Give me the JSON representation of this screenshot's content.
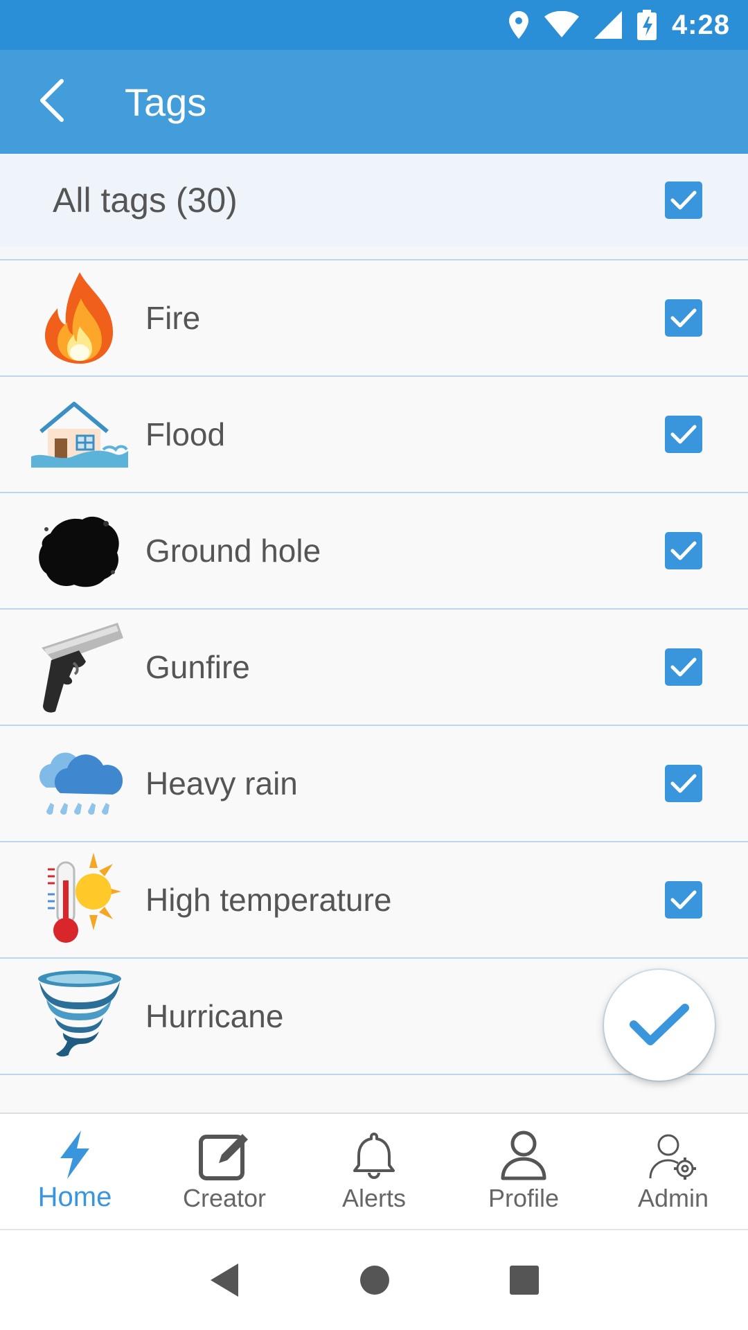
{
  "status_bar": {
    "time": "4:28"
  },
  "app_bar": {
    "title": "Tags"
  },
  "all_tags": {
    "label": "All tags (30)",
    "checked": true
  },
  "tags": [
    {
      "label": "Fire",
      "icon": "fire-icon",
      "checked": true
    },
    {
      "label": "Flood",
      "icon": "flood-house-icon",
      "checked": true
    },
    {
      "label": "Ground hole",
      "icon": "ground-hole-icon",
      "checked": true
    },
    {
      "label": "Gunfire",
      "icon": "pistol-icon",
      "checked": true
    },
    {
      "label": "Heavy rain",
      "icon": "rain-cloud-icon",
      "checked": true
    },
    {
      "label": "High temperature",
      "icon": "thermometer-sun-icon",
      "checked": true
    },
    {
      "label": "Hurricane",
      "icon": "tornado-icon",
      "checked": true
    }
  ],
  "bottom_nav": [
    {
      "label": "Home",
      "icon": "lightning-icon",
      "active": true
    },
    {
      "label": "Creator",
      "icon": "edit-icon",
      "active": false
    },
    {
      "label": "Alerts",
      "icon": "bell-icon",
      "active": false
    },
    {
      "label": "Profile",
      "icon": "user-icon",
      "active": false
    },
    {
      "label": "Admin",
      "icon": "admin-gear-icon",
      "active": false
    }
  ],
  "colors": {
    "status_bar": "#2a8fd6",
    "app_bar": "#439ddb",
    "accent": "#3a96dc",
    "divider": "#b9d6ef"
  }
}
